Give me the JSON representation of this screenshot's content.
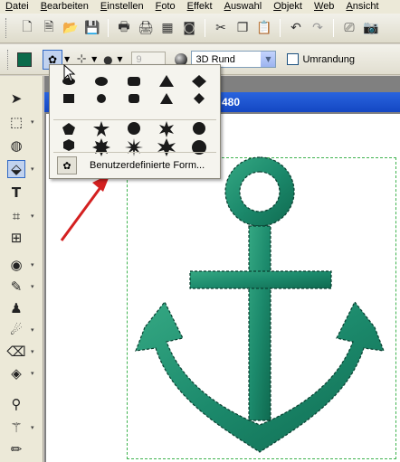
{
  "menu": [
    "Datei",
    "Bearbeiten",
    "Einstellen",
    "Foto",
    "Effekt",
    "Auswahl",
    "Objekt",
    "Web",
    "Ansicht"
  ],
  "toolbar": {
    "icons": [
      "new-document-icon",
      "new-from-template-icon",
      "open-icon",
      "save-icon",
      "print-icon",
      "print-preview-icon",
      "print-layout-icon",
      "capture-icon",
      "cut-icon",
      "copy-icon",
      "paste-icon",
      "undo-icon",
      "redo-icon",
      "scanner-icon",
      "camera-icon"
    ]
  },
  "options": {
    "foreground_color": "#0b6b4b",
    "size_value": "9",
    "style_value": "3D Rund",
    "outline_label": "Umrandung",
    "outline_checked": false
  },
  "document": {
    "title_fragment": "480"
  },
  "shape_menu": {
    "custom_label": "Benutzerdefinierte Form...",
    "basic_shapes": [
      "ellipse",
      "circle",
      "rounded-rectangle",
      "triangle-up",
      "diamond",
      "rectangle",
      "circle-small",
      "rounded-rectangle-small",
      "triangle-up-small",
      "diamond-small"
    ],
    "star_shapes": [
      "pentagon",
      "star-5",
      "badge",
      "asterisk-6",
      "spiral-star",
      "hexagon",
      "star-8",
      "starburst",
      "flower-star",
      "seal"
    ]
  },
  "colors": {
    "anchor_fill": "#1c8a6c",
    "selection": "#3fb34f",
    "arrow": "#d42020",
    "title_bar": "#1447c3"
  }
}
